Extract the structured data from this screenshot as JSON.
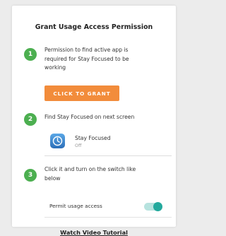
{
  "dialog": {
    "title": "Grant Usage Access Permission"
  },
  "steps": [
    {
      "number": "1",
      "text_lines": [
        "Permission to find active app is",
        "required for Stay Focused to be",
        "working"
      ]
    },
    {
      "number": "2",
      "text_lines": [
        "Find Stay Focused on next screen"
      ]
    },
    {
      "number": "3",
      "text_lines": [
        "Click it and turn on the switch like",
        "below"
      ]
    }
  ],
  "grant_button": {
    "label": "CLICK TO GRANT"
  },
  "app_entry": {
    "name": "Stay Focused",
    "status": "Off",
    "icon": "stay-focused-app-icon"
  },
  "permit": {
    "label": "Permit usage access",
    "toggle_on": true
  },
  "video_link": {
    "label": "Watch Video Tutorial"
  },
  "colors": {
    "step_badge": "#4caf50",
    "grant_button": "#f28c3b",
    "toggle_knob": "#23a99d",
    "toggle_track": "#b7e3df"
  }
}
